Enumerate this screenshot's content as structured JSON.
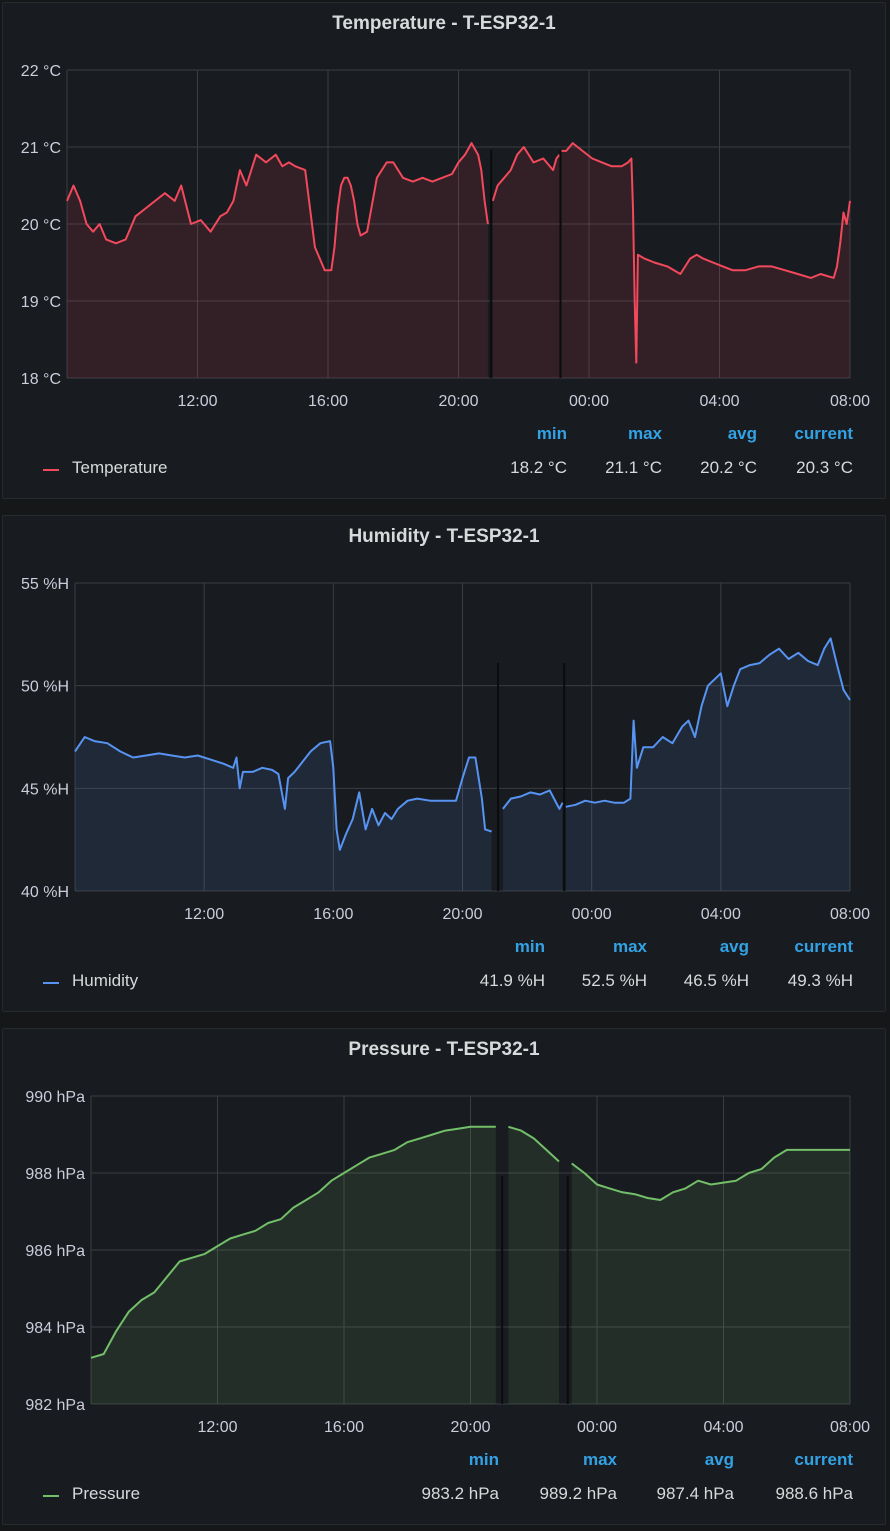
{
  "panels": [
    {
      "title": "Temperature - T-ESP32-1",
      "legend": {
        "name": "Temperature",
        "headers": [
          "min",
          "max",
          "avg",
          "current"
        ],
        "values": [
          "18.2 °C",
          "21.1 °C",
          "20.2 °C",
          "20.3 °C"
        ]
      }
    },
    {
      "title": "Humidity - T-ESP32-1",
      "legend": {
        "name": "Humidity",
        "headers": [
          "min",
          "max",
          "avg",
          "current"
        ],
        "values": [
          "41.9 %H",
          "52.5 %H",
          "46.5 %H",
          "49.3 %H"
        ]
      }
    },
    {
      "title": "Pressure - T-ESP32-1",
      "legend": {
        "name": "Pressure",
        "headers": [
          "min",
          "max",
          "avg",
          "current"
        ],
        "values": [
          "983.2 hPa",
          "989.2 hPa",
          "987.4 hPa",
          "988.6 hPa"
        ]
      }
    }
  ],
  "chart_data": [
    {
      "type": "area",
      "title": "Temperature - T-ESP32-1",
      "unit": "°C",
      "color": "#f2495c",
      "ylim": [
        18,
        22
      ],
      "yticks": [
        18,
        19,
        20,
        21,
        22
      ],
      "ytick_labels": [
        "18 °C",
        "19 °C",
        "20 °C",
        "21 °C",
        "22 °C"
      ],
      "xlim": [
        8.0,
        32.0
      ],
      "xticks": [
        12,
        16,
        20,
        24,
        28,
        32
      ],
      "xtick_labels": [
        "12:00",
        "16:00",
        "20:00",
        "00:00",
        "04:00",
        "08:00"
      ],
      "grid": true,
      "gaps": [
        [
          20.95,
          21.05
        ],
        [
          23.1,
          23.15
        ]
      ],
      "series": [
        {
          "name": "Temperature",
          "x": [
            8.0,
            8.2,
            8.4,
            8.6,
            8.8,
            9.0,
            9.2,
            9.5,
            9.8,
            10.1,
            10.4,
            10.7,
            11.0,
            11.3,
            11.5,
            11.8,
            12.1,
            12.4,
            12.7,
            12.9,
            13.1,
            13.3,
            13.5,
            13.8,
            14.1,
            14.4,
            14.6,
            14.8,
            15.0,
            15.3,
            15.6,
            15.9,
            16.1,
            16.2,
            16.3,
            16.4,
            16.5,
            16.6,
            16.7,
            16.8,
            16.9,
            17.0,
            17.2,
            17.5,
            17.8,
            18.0,
            18.3,
            18.6,
            18.9,
            19.2,
            19.5,
            19.8,
            20.0,
            20.2,
            20.4,
            20.6,
            20.7,
            20.8,
            20.9,
            21.05,
            21.2,
            21.4,
            21.6,
            21.8,
            22.0,
            22.3,
            22.6,
            22.9,
            23.0,
            23.1,
            23.15,
            23.3,
            23.5,
            23.8,
            24.1,
            24.4,
            24.7,
            25.0,
            25.2,
            25.3,
            25.35,
            25.4,
            25.45,
            25.5,
            25.7,
            26.0,
            26.4,
            26.8,
            27.1,
            27.3,
            27.5,
            27.8,
            28.1,
            28.4,
            28.8,
            29.2,
            29.6,
            30.0,
            30.4,
            30.8,
            31.1,
            31.5,
            31.6,
            31.7,
            31.8,
            31.9,
            32.0
          ],
          "y": [
            20.3,
            20.5,
            20.3,
            20.0,
            19.9,
            20.0,
            19.8,
            19.75,
            19.8,
            20.1,
            20.2,
            20.3,
            20.4,
            20.3,
            20.5,
            20.0,
            20.05,
            19.9,
            20.1,
            20.15,
            20.3,
            20.7,
            20.5,
            20.9,
            20.8,
            20.9,
            20.75,
            20.8,
            20.75,
            20.7,
            19.7,
            19.4,
            19.4,
            19.7,
            20.2,
            20.5,
            20.6,
            20.6,
            20.5,
            20.3,
            20.0,
            19.85,
            19.9,
            20.6,
            20.8,
            20.8,
            20.6,
            20.55,
            20.6,
            20.55,
            20.6,
            20.65,
            20.8,
            20.9,
            21.05,
            20.9,
            20.7,
            20.3,
            20.0,
            20.3,
            20.5,
            20.6,
            20.7,
            20.9,
            21.0,
            20.8,
            20.85,
            20.7,
            20.85,
            20.9,
            20.95,
            20.95,
            21.05,
            20.95,
            20.85,
            20.8,
            20.75,
            20.75,
            20.8,
            20.85,
            20.2,
            19.0,
            18.2,
            19.6,
            19.55,
            19.5,
            19.45,
            19.35,
            19.55,
            19.6,
            19.55,
            19.5,
            19.45,
            19.4,
            19.4,
            19.45,
            19.45,
            19.4,
            19.35,
            19.3,
            19.35,
            19.3,
            19.45,
            19.75,
            20.15,
            20.0,
            20.3
          ]
        }
      ]
    },
    {
      "type": "area",
      "title": "Humidity - T-ESP32-1",
      "unit": "%H",
      "color": "#5794f2",
      "ylim": [
        40,
        55
      ],
      "yticks": [
        40,
        45,
        50,
        55
      ],
      "ytick_labels": [
        "40 %H",
        "45 %H",
        "50 %H",
        "55 %H"
      ],
      "xlim": [
        8.0,
        32.0
      ],
      "xticks": [
        12,
        16,
        20,
        24,
        28,
        32
      ],
      "xtick_labels": [
        "12:00",
        "16:00",
        "20:00",
        "00:00",
        "04:00",
        "08:00"
      ],
      "grid": true,
      "gaps": [
        [
          20.95,
          21.25
        ],
        [
          23.1,
          23.2
        ]
      ],
      "series": [
        {
          "name": "Humidity",
          "x": [
            8.0,
            8.3,
            8.6,
            9.0,
            9.4,
            9.8,
            10.2,
            10.6,
            11.0,
            11.4,
            11.8,
            12.2,
            12.6,
            12.9,
            13.0,
            13.1,
            13.2,
            13.5,
            13.8,
            14.1,
            14.3,
            14.5,
            14.6,
            14.8,
            15.0,
            15.3,
            15.6,
            15.9,
            16.0,
            16.1,
            16.2,
            16.4,
            16.6,
            16.8,
            17.0,
            17.2,
            17.4,
            17.6,
            17.8,
            18.0,
            18.3,
            18.6,
            19.0,
            19.4,
            19.8,
            20.0,
            20.2,
            20.4,
            20.6,
            20.7,
            20.9,
            21.25,
            21.5,
            21.8,
            22.1,
            22.4,
            22.7,
            23.0,
            23.1,
            23.2,
            23.5,
            23.8,
            24.1,
            24.4,
            24.7,
            25.0,
            25.2,
            25.3,
            25.4,
            25.6,
            25.9,
            26.2,
            26.5,
            26.8,
            27.0,
            27.2,
            27.4,
            27.6,
            27.8,
            28.0,
            28.2,
            28.4,
            28.6,
            28.9,
            29.2,
            29.5,
            29.8,
            30.1,
            30.4,
            30.7,
            31.0,
            31.2,
            31.4,
            31.6,
            31.8,
            32.0
          ],
          "y": [
            46.8,
            47.5,
            47.3,
            47.2,
            46.8,
            46.5,
            46.6,
            46.7,
            46.6,
            46.5,
            46.6,
            46.4,
            46.2,
            46.0,
            46.5,
            45.0,
            45.8,
            45.8,
            46.0,
            45.9,
            45.7,
            44.0,
            45.5,
            45.8,
            46.2,
            46.8,
            47.2,
            47.3,
            46.0,
            43.0,
            42.0,
            42.8,
            43.5,
            44.8,
            43.0,
            44.0,
            43.2,
            43.8,
            43.5,
            44.0,
            44.4,
            44.5,
            44.4,
            44.4,
            44.4,
            45.5,
            46.5,
            46.5,
            44.5,
            43.0,
            42.9,
            44.0,
            44.5,
            44.6,
            44.8,
            44.7,
            44.9,
            44.0,
            44.3,
            44.1,
            44.2,
            44.4,
            44.3,
            44.4,
            44.3,
            44.3,
            44.5,
            48.3,
            46.0,
            47.0,
            47.0,
            47.5,
            47.2,
            48.0,
            48.3,
            47.5,
            49.0,
            50.0,
            50.3,
            50.6,
            49.0,
            50.0,
            50.8,
            51.0,
            51.1,
            51.5,
            51.8,
            51.3,
            51.6,
            51.2,
            51.0,
            51.8,
            52.3,
            51.0,
            49.8,
            49.3
          ]
        }
      ]
    },
    {
      "type": "area",
      "title": "Pressure - T-ESP32-1",
      "unit": "hPa",
      "color": "#73bf69",
      "ylim": [
        982,
        990
      ],
      "yticks": [
        982,
        984,
        986,
        988,
        990
      ],
      "ytick_labels": [
        "982 hPa",
        "984 hPa",
        "986 hPa",
        "988 hPa",
        "990 hPa"
      ],
      "xlim": [
        8.0,
        32.0
      ],
      "xticks": [
        12,
        16,
        20,
        24,
        28,
        32
      ],
      "xtick_labels": [
        "12:00",
        "16:00",
        "20:00",
        "00:00",
        "04:00",
        "08:00"
      ],
      "grid": true,
      "gaps": [
        [
          20.95,
          21.05
        ],
        [
          23.05,
          23.1
        ]
      ],
      "series": [
        {
          "name": "Pressure",
          "x": [
            8.0,
            8.4,
            8.8,
            9.2,
            9.6,
            10.0,
            10.4,
            10.8,
            11.2,
            11.6,
            12.0,
            12.4,
            12.8,
            13.2,
            13.6,
            14.0,
            14.4,
            14.8,
            15.2,
            15.6,
            16.0,
            16.4,
            16.8,
            17.2,
            17.6,
            18.0,
            18.4,
            18.8,
            19.2,
            19.6,
            20.0,
            20.4,
            20.8,
            21.2,
            21.6,
            22.0,
            22.4,
            22.8,
            23.2,
            23.6,
            24.0,
            24.4,
            24.8,
            25.2,
            25.6,
            26.0,
            26.4,
            26.8,
            27.2,
            27.6,
            28.0,
            28.4,
            28.8,
            29.2,
            29.6,
            30.0,
            30.4,
            30.8,
            31.2,
            31.6,
            32.0
          ],
          "y": [
            983.2,
            983.3,
            983.9,
            984.4,
            984.7,
            984.9,
            985.3,
            985.7,
            985.8,
            985.9,
            986.1,
            986.3,
            986.4,
            986.5,
            986.7,
            986.8,
            987.1,
            987.3,
            987.5,
            987.8,
            988.0,
            988.2,
            988.4,
            988.5,
            988.6,
            988.8,
            988.9,
            989.0,
            989.1,
            989.15,
            989.2,
            989.2,
            989.2,
            989.2,
            989.1,
            988.9,
            988.6,
            988.3,
            988.25,
            988.0,
            987.7,
            987.6,
            987.5,
            987.45,
            987.35,
            987.3,
            987.5,
            987.6,
            987.8,
            987.7,
            987.75,
            987.8,
            988.0,
            988.1,
            988.4,
            988.6,
            988.6,
            988.6,
            988.6,
            988.6,
            988.6
          ]
        }
      ]
    }
  ]
}
